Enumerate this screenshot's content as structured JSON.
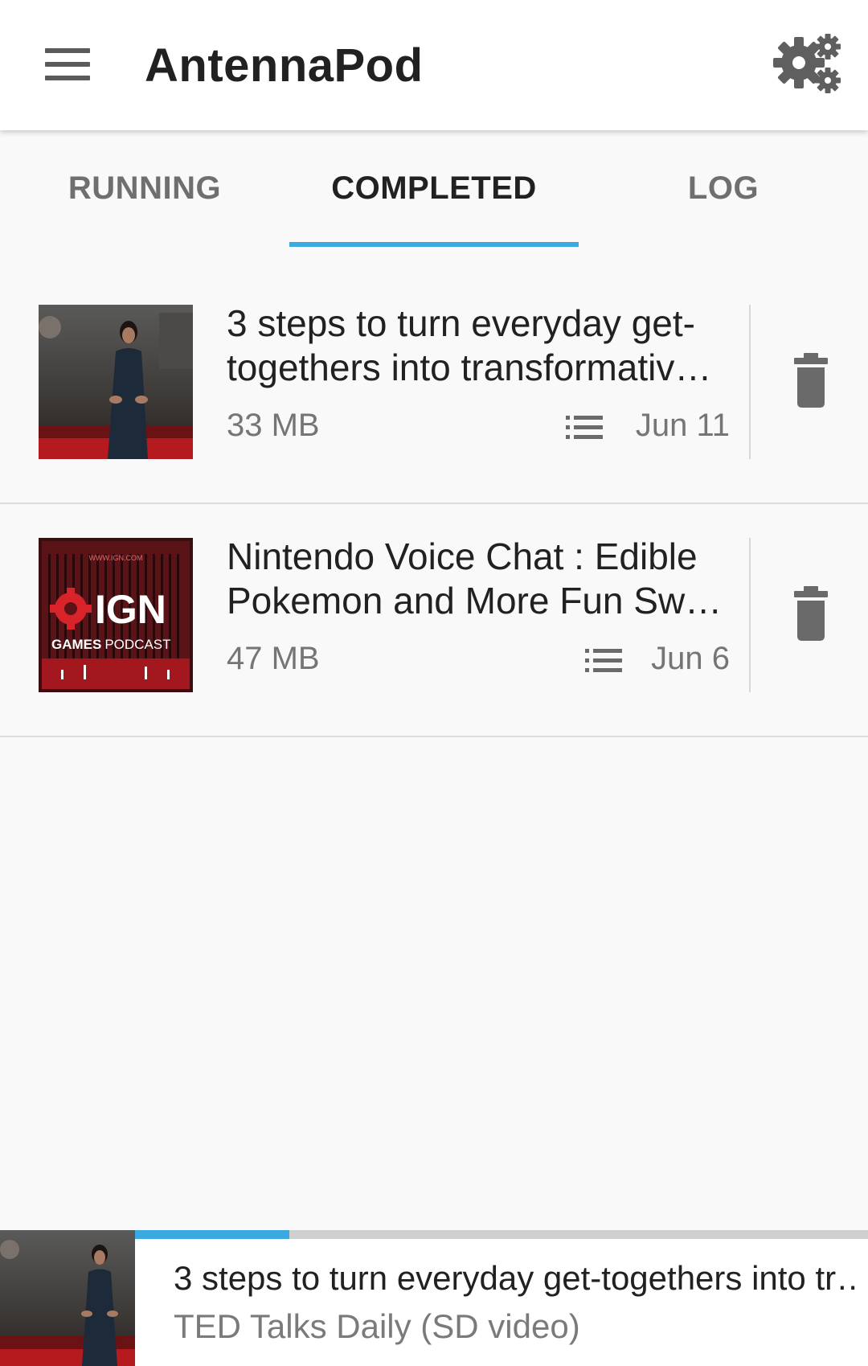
{
  "app": {
    "title": "AntennaPod"
  },
  "icons": {
    "menu": "hamburger-menu-icon",
    "settings": "gears-icon",
    "description": "list-icon",
    "delete": "trash-icon"
  },
  "colors": {
    "accent": "#3aa9e0",
    "text_primary": "#212121",
    "text_secondary": "#757575"
  },
  "tabs": [
    {
      "label": "RUNNING",
      "active": false
    },
    {
      "label": "COMPLETED",
      "active": true
    },
    {
      "label": "LOG",
      "active": false
    }
  ],
  "downloads": [
    {
      "title": "3 steps to turn everyday get-togethers into transformativ…",
      "size": "33 MB",
      "date": "Jun 11"
    },
    {
      "title": "Nintendo Voice Chat : Edible Pokemon and More Fun Sw…",
      "size": "47 MB",
      "date": "Jun 6",
      "cover": {
        "site": "WWW.IGN.COM",
        "logo": "IGN",
        "line_bold": "GAMES",
        "line_light": "PODCAST"
      }
    }
  ],
  "player": {
    "title": "3 steps to turn everyday get-togethers into tr…",
    "subtitle": "TED Talks Daily (SD video)",
    "progress": 0.21
  }
}
